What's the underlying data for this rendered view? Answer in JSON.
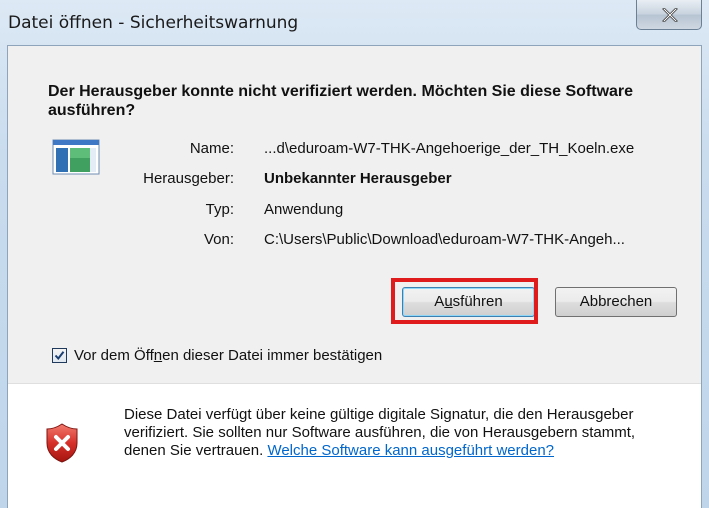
{
  "window": {
    "title": "Datei öffnen - Sicherheitswarnung"
  },
  "heading": "Der Herausgeber konnte nicht verifiziert werden. Möchten Sie diese Software ausführen?",
  "file_info": {
    "name_label": "Name:",
    "name_value": "...d\\eduroam-W7-THK-Angehoerige_der_TH_Koeln.exe",
    "publisher_label": "Herausgeber:",
    "publisher_value": "Unbekannter Herausgeber",
    "type_label": "Typ:",
    "type_value": "Anwendung",
    "from_label": "Von:",
    "from_value": "C:\\Users\\Public\\Download\\eduroam-W7-THK-Angeh..."
  },
  "buttons": {
    "run_prefix": "A",
    "run_access": "u",
    "run_rest": "sführen",
    "cancel": "Abbrechen"
  },
  "checkbox": {
    "checked": true,
    "label_before": "Vor dem Öff",
    "label_access": "n",
    "label_after": "en dieser Datei immer bestätigen"
  },
  "warning": {
    "text": "Diese Datei verfügt über keine gültige digitale Signatur, die den Herausgeber verifiziert. Sie sollten nur Software ausführen, die von Herausgebern stammt, denen Sie vertrauen. ",
    "link": "Welche Software kann ausgeführt werden?"
  },
  "colors": {
    "highlight": "#e01b1b",
    "link": "#0066cc"
  }
}
